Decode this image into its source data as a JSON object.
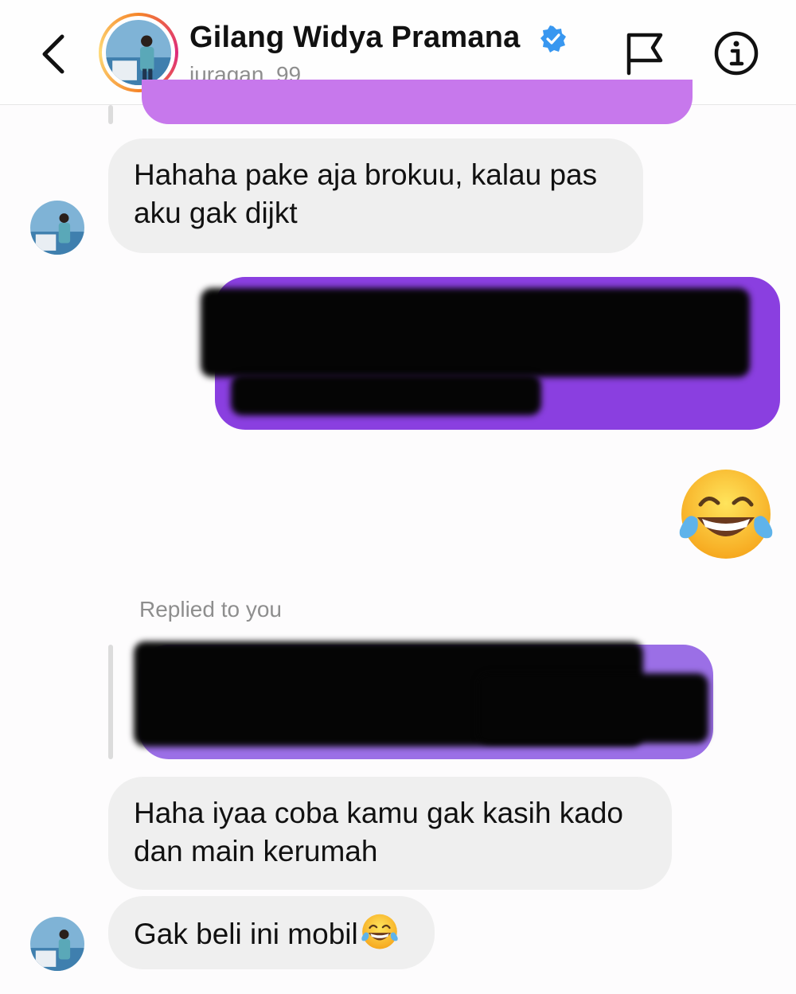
{
  "header": {
    "contact_name": "Gilang Widya Pramana",
    "username": "juragan_99"
  },
  "icons": {
    "back": "chevron-left-icon",
    "verified": "verified-badge-icon",
    "report": "flag-icon",
    "info": "info-icon",
    "emoji": "face-with-tears-of-joy"
  },
  "colors": {
    "accent_purple": "#8a3fe0",
    "received_bubble": "#efefef",
    "verified_blue": "#3897f0"
  },
  "messages": [
    {
      "from": "contact",
      "text": "Hahaha pake aja brokuu, kalau pas aku gak dijkt"
    },
    {
      "from": "me",
      "text": "",
      "redacted": true
    },
    {
      "from": "me",
      "emoji": "😂"
    },
    {
      "from": "contact",
      "reply_label": "Replied to you",
      "quoted_redacted": true
    },
    {
      "from": "contact",
      "text": "Haha iyaa coba kamu gak kasih kado dan main kerumah"
    },
    {
      "from": "contact",
      "text": "Gak beli ini mobil"
    }
  ]
}
